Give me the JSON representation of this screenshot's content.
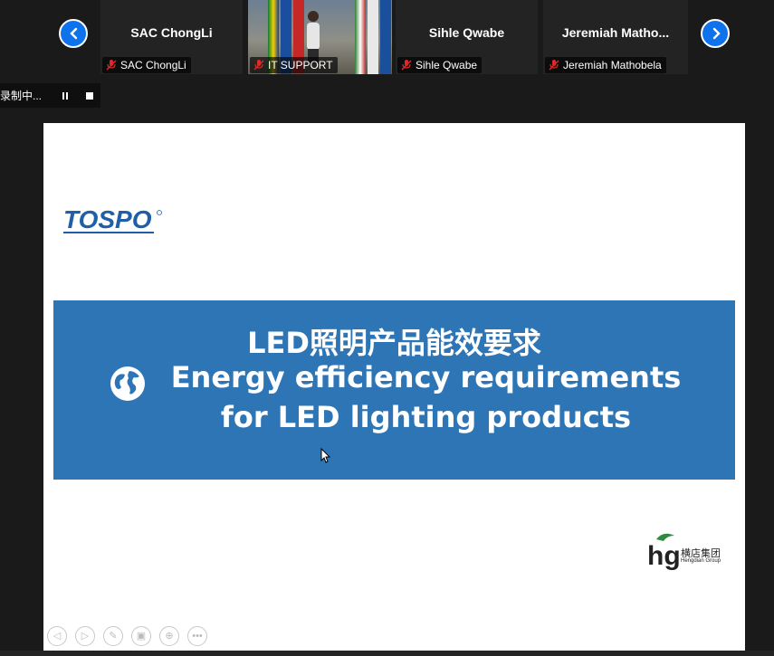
{
  "gallery": {
    "prev_label": "‹",
    "next_label": "›",
    "tiles": [
      {
        "name": "SAC ChongLi",
        "tag": "SAC ChongLi"
      },
      {
        "name": "",
        "tag": "IT SUPPORT"
      },
      {
        "name": "Sihle Qwabe",
        "tag": "Sihle Qwabe"
      },
      {
        "name": "Jeremiah  Matho...",
        "tag": "Jeremiah Mathobela"
      }
    ]
  },
  "recording": {
    "status": "录制中..."
  },
  "slide": {
    "logo_text": "TOSPO",
    "banner_line1": "LED照明产品能效要求",
    "banner_line2": "Energy efficiency requirements",
    "banner_line3": "for LED lighting products",
    "brand_mark": "hg",
    "brand_cn": "横店集团",
    "brand_en": "Hengdian Group"
  },
  "slide_controls": [
    "◁",
    "▷",
    "✎",
    "▣",
    "⊕",
    "•••"
  ],
  "colors": {
    "accent": "#0e72ed",
    "banner": "#2e75b6",
    "mute": "#e02828"
  }
}
